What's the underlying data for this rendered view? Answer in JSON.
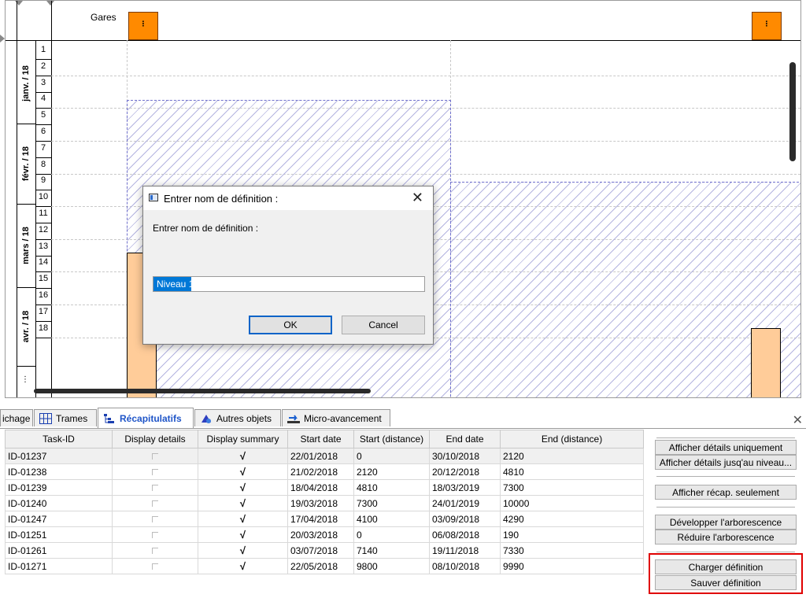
{
  "graph": {
    "header_label": "Gares",
    "row_numbers": [
      "1",
      "2",
      "3",
      "4",
      "5",
      "6",
      "7",
      "8",
      "9",
      "10",
      "11",
      "12",
      "13",
      "14",
      "15",
      "16",
      "17",
      "18"
    ],
    "months": [
      "janv. / 18",
      "févr. / 18",
      "mars / 18",
      "avr. / 18"
    ],
    "more_marker": "⋮",
    "orange_glyph": "⋮"
  },
  "dialog": {
    "title": "Entrer nom de définition :",
    "prompt": "Entrer nom de définition :",
    "input_value": "Niveau 1",
    "ok_label": "OK",
    "cancel_label": "Cancel",
    "close_glyph": "✕"
  },
  "tabs": [
    {
      "label": "ichage",
      "icon": "display-icon",
      "active": false
    },
    {
      "label": "Trames",
      "icon": "grid-icon",
      "active": false
    },
    {
      "label": "Récapitulatifs",
      "icon": "summary-tree-icon",
      "active": true
    },
    {
      "label": "Autres objets",
      "icon": "objects-icon",
      "active": false
    },
    {
      "label": "Micro-avancement",
      "icon": "micro-progress-icon",
      "active": false
    }
  ],
  "panel_close": "✕",
  "table": {
    "headers": [
      "Task-ID",
      "Display details",
      "Display summary",
      "Start date",
      "Start (distance)",
      "End date",
      "End (distance)"
    ],
    "rows": [
      {
        "id": "ID-01237",
        "details": false,
        "summary": true,
        "start": "22/01/2018",
        "start_dist": "0",
        "end": "30/10/2018",
        "end_dist": "2120"
      },
      {
        "id": "ID-01238",
        "details": false,
        "summary": true,
        "start": "21/02/2018",
        "start_dist": "2120",
        "end": "20/12/2018",
        "end_dist": "4810"
      },
      {
        "id": "ID-01239",
        "details": false,
        "summary": true,
        "start": "18/04/2018",
        "start_dist": "4810",
        "end": "18/03/2019",
        "end_dist": "7300"
      },
      {
        "id": "ID-01240",
        "details": false,
        "summary": true,
        "start": "19/03/2018",
        "start_dist": "7300",
        "end": "24/01/2019",
        "end_dist": "10000"
      },
      {
        "id": "ID-01247",
        "details": false,
        "summary": true,
        "start": "17/04/2018",
        "start_dist": "4100",
        "end": "03/09/2018",
        "end_dist": "4290"
      },
      {
        "id": "ID-01251",
        "details": false,
        "summary": true,
        "start": "20/03/2018",
        "start_dist": "0",
        "end": "06/08/2018",
        "end_dist": "190"
      },
      {
        "id": "ID-01261",
        "details": false,
        "summary": true,
        "start": "03/07/2018",
        "start_dist": "7140",
        "end": "19/11/2018",
        "end_dist": "7330"
      },
      {
        "id": "ID-01271",
        "details": false,
        "summary": true,
        "start": "22/05/2018",
        "start_dist": "9800",
        "end": "08/10/2018",
        "end_dist": "9990"
      }
    ],
    "tick_glyph": "√"
  },
  "side_buttons": {
    "details_only": "Afficher détails uniquement",
    "details_to_level": "Afficher détails jusq'au niveau...",
    "summary_only": "Afficher récap. seulement",
    "expand_tree": "Développer l'arborescence",
    "collapse_tree": "Réduire l'arborescence",
    "load_definition": "Charger définition",
    "save_definition": "Sauver définition"
  },
  "colors": {
    "accent_tab": "#1f55c8",
    "orange": "#ff8a00",
    "peach": "#ffcc99",
    "hatch": "#b4b4e0",
    "highlight_box": "#e00000"
  }
}
